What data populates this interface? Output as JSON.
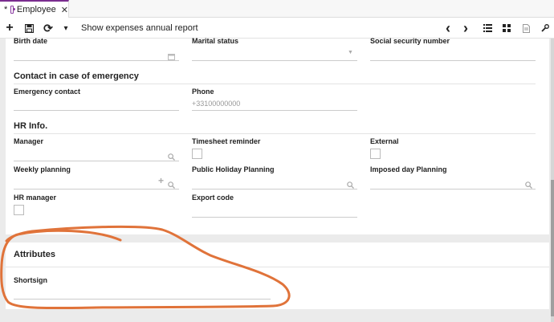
{
  "tab": {
    "modified_marker": "*",
    "label": "Employee",
    "close": "✕"
  },
  "toolbar": {
    "report_label": "Show expenses annual report",
    "add": "+",
    "save": "💾",
    "refresh": "⟳",
    "more": "▾",
    "prev": "‹",
    "next": "›"
  },
  "form": {
    "birth_date_label": "Birth date",
    "marital_status_label": "Marital status",
    "ssn_label": "Social security number",
    "emergency_section": "Contact in case of emergency",
    "emergency_contact_label": "Emergency contact",
    "phone_label": "Phone",
    "phone_placeholder": "+33100000000",
    "hr_section": "HR Info.",
    "manager_label": "Manager",
    "timesheet_reminder_label": "Timesheet reminder",
    "external_label": "External",
    "weekly_planning_label": "Weekly planning",
    "public_holiday_label": "Public Holiday Planning",
    "imposed_day_label": "Imposed day Planning",
    "hr_manager_label": "HR manager",
    "export_code_label": "Export code"
  },
  "attributes": {
    "section": "Attributes",
    "shortsign_label": "Shortsign"
  },
  "colors": {
    "accent": "#7a2d8f",
    "annotation": "#e0733a"
  }
}
